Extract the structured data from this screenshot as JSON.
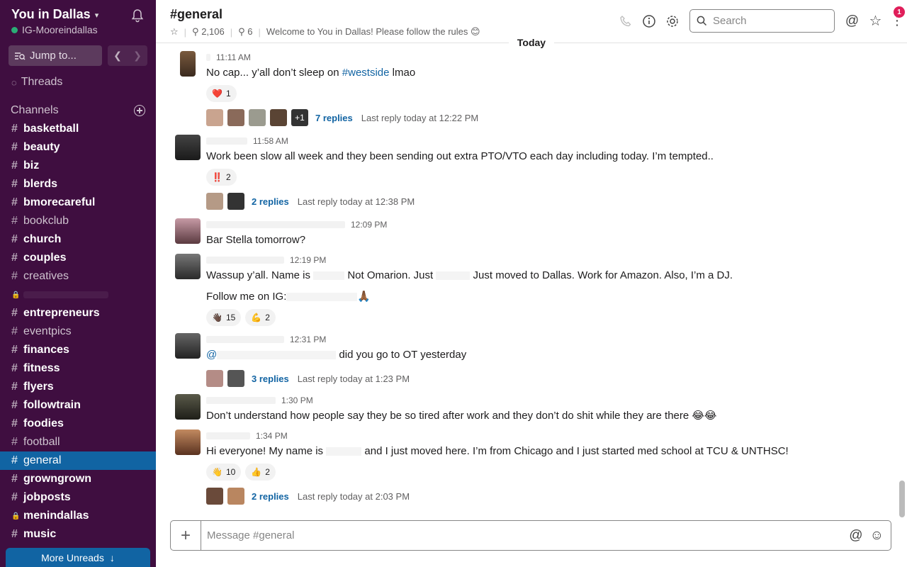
{
  "workspace": {
    "name": "You in Dallas",
    "user": "IG-Mooreindallas"
  },
  "sidebar": {
    "jump_label": "Jump to...",
    "threads_label": "Threads",
    "channels_heading": "Channels",
    "channels": [
      {
        "name": "basketball",
        "unread": true
      },
      {
        "name": "beauty",
        "unread": true
      },
      {
        "name": "biz",
        "unread": true
      },
      {
        "name": "blerds",
        "unread": true
      },
      {
        "name": "bmorecareful",
        "unread": true
      },
      {
        "name": "bookclub",
        "unread": false
      },
      {
        "name": "church",
        "unread": true
      },
      {
        "name": "couples",
        "unread": true
      },
      {
        "name": "creatives",
        "unread": false
      },
      {
        "name": "",
        "private": true
      },
      {
        "name": "entrepreneurs",
        "unread": true
      },
      {
        "name": "eventpics",
        "unread": false
      },
      {
        "name": "finances",
        "unread": true
      },
      {
        "name": "fitness",
        "unread": true
      },
      {
        "name": "flyers",
        "unread": true
      },
      {
        "name": "followtrain",
        "unread": true
      },
      {
        "name": "foodies",
        "unread": true
      },
      {
        "name": "football",
        "unread": false
      },
      {
        "name": "general",
        "active": true
      },
      {
        "name": "growngrown",
        "unread": true
      },
      {
        "name": "jobposts",
        "unread": true
      },
      {
        "name": "menindallas",
        "unread": true,
        "private": true
      },
      {
        "name": "music",
        "unread": true
      }
    ],
    "more_unreads": "More Unreads"
  },
  "header": {
    "title": "#general",
    "members": "2,106",
    "pins": "6",
    "topic": "Welcome to You in Dallas! Please follow the rules 😊",
    "search_placeholder": "Search",
    "badge": "1",
    "date_divider": "Today"
  },
  "messages": [
    {
      "time": "11:11 AM",
      "text_before": "No cap... y’all don’t sleep on ",
      "link": "#westside",
      "text_after": " lmao",
      "reactions": [
        {
          "emoji": "❤️",
          "count": "1"
        }
      ],
      "reply_more": "+1",
      "replies": "7 replies",
      "last_reply": "Last reply today at 12:22 PM"
    },
    {
      "time": "11:58 AM",
      "text": "Work been slow all week and they been sending out extra PTO/VTO each day including today. I’m tempted..",
      "reactions": [
        {
          "emoji": "‼️",
          "count": "2"
        }
      ],
      "replies": "2 replies",
      "last_reply": "Last reply today at 12:38 PM"
    },
    {
      "time": "12:09 PM",
      "text": "Bar Stella tomorrow?"
    },
    {
      "time": "12:19 PM",
      "text_a": "Wassup y’all. Name is ",
      "text_b": " Not Omarion. Just ",
      "text_c": " Just moved to Dallas. Work for Amazon. Also, I’m a DJ.",
      "text2": "Follow me on IG:",
      "text2_emoji": "🙏🏾",
      "reactions": [
        {
          "emoji": "👋🏿",
          "count": "15"
        },
        {
          "emoji": "💪",
          "count": "2"
        }
      ]
    },
    {
      "time": "12:31 PM",
      "mention": "@",
      "text": "did you go to OT yesterday",
      "replies": "3 replies",
      "last_reply": "Last reply today at 1:23 PM"
    },
    {
      "time": "1:30 PM",
      "text": "Don’t understand how people say they be so tired after work and they don’t do shit while they are there  😂😂"
    },
    {
      "time": "1:34 PM",
      "text_a": "Hi everyone! My name is ",
      "text_b": " and I just moved here. I’m from Chicago and I just started med school at TCU & UNTHSC!",
      "reactions": [
        {
          "emoji": "👋",
          "count": "10"
        },
        {
          "emoji": "👍",
          "count": "2"
        }
      ],
      "replies": "2 replies",
      "last_reply": "Last reply today at 2:03 PM"
    }
  ],
  "composer": {
    "placeholder": "Message #general"
  }
}
